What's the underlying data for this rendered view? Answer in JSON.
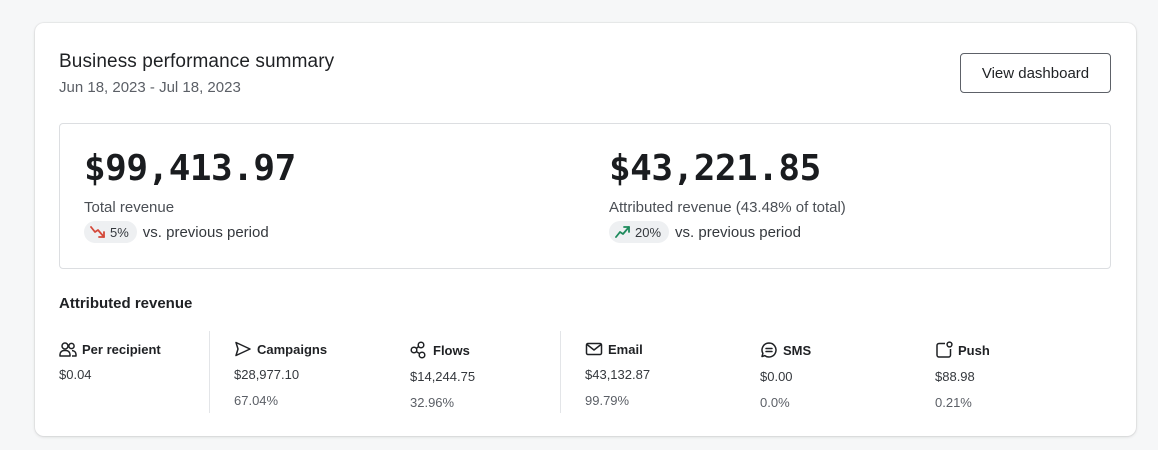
{
  "summary": {
    "title": "Business performance summary",
    "date_range": "Jun 18, 2023 - Jul 18, 2023",
    "view_dashboard_label": "View dashboard"
  },
  "total_revenue": {
    "value": "$99,413.97",
    "label": "Total revenue",
    "change": "5%",
    "change_direction": "down",
    "comparison": "vs. previous period"
  },
  "attributed_revenue_summary": {
    "value": "$43,221.85",
    "label": "Attributed revenue (43.48% of total)",
    "change": "20%",
    "change_direction": "up",
    "comparison": "vs. previous period"
  },
  "attributed": {
    "title": "Attributed revenue",
    "metrics": [
      {
        "label": "Per recipient",
        "icon": "people-icon",
        "value": "$0.04",
        "percent": ""
      },
      {
        "label": "Campaigns",
        "icon": "send-icon",
        "value": "$28,977.10",
        "percent": "67.04%"
      },
      {
        "label": "Flows",
        "icon": "flows-icon",
        "value": "$14,244.75",
        "percent": "32.96%"
      },
      {
        "label": "Email",
        "icon": "mail-icon",
        "value": "$43,132.87",
        "percent": "99.79%"
      },
      {
        "label": "SMS",
        "icon": "sms-icon",
        "value": "$0.00",
        "percent": "0.0%"
      },
      {
        "label": "Push",
        "icon": "push-icon",
        "value": "$88.98",
        "percent": "0.21%"
      }
    ]
  },
  "colors": {
    "trend_down": "#d4493a",
    "trend_up": "#1d8a5c",
    "pill_bg": "#eef0f2"
  }
}
